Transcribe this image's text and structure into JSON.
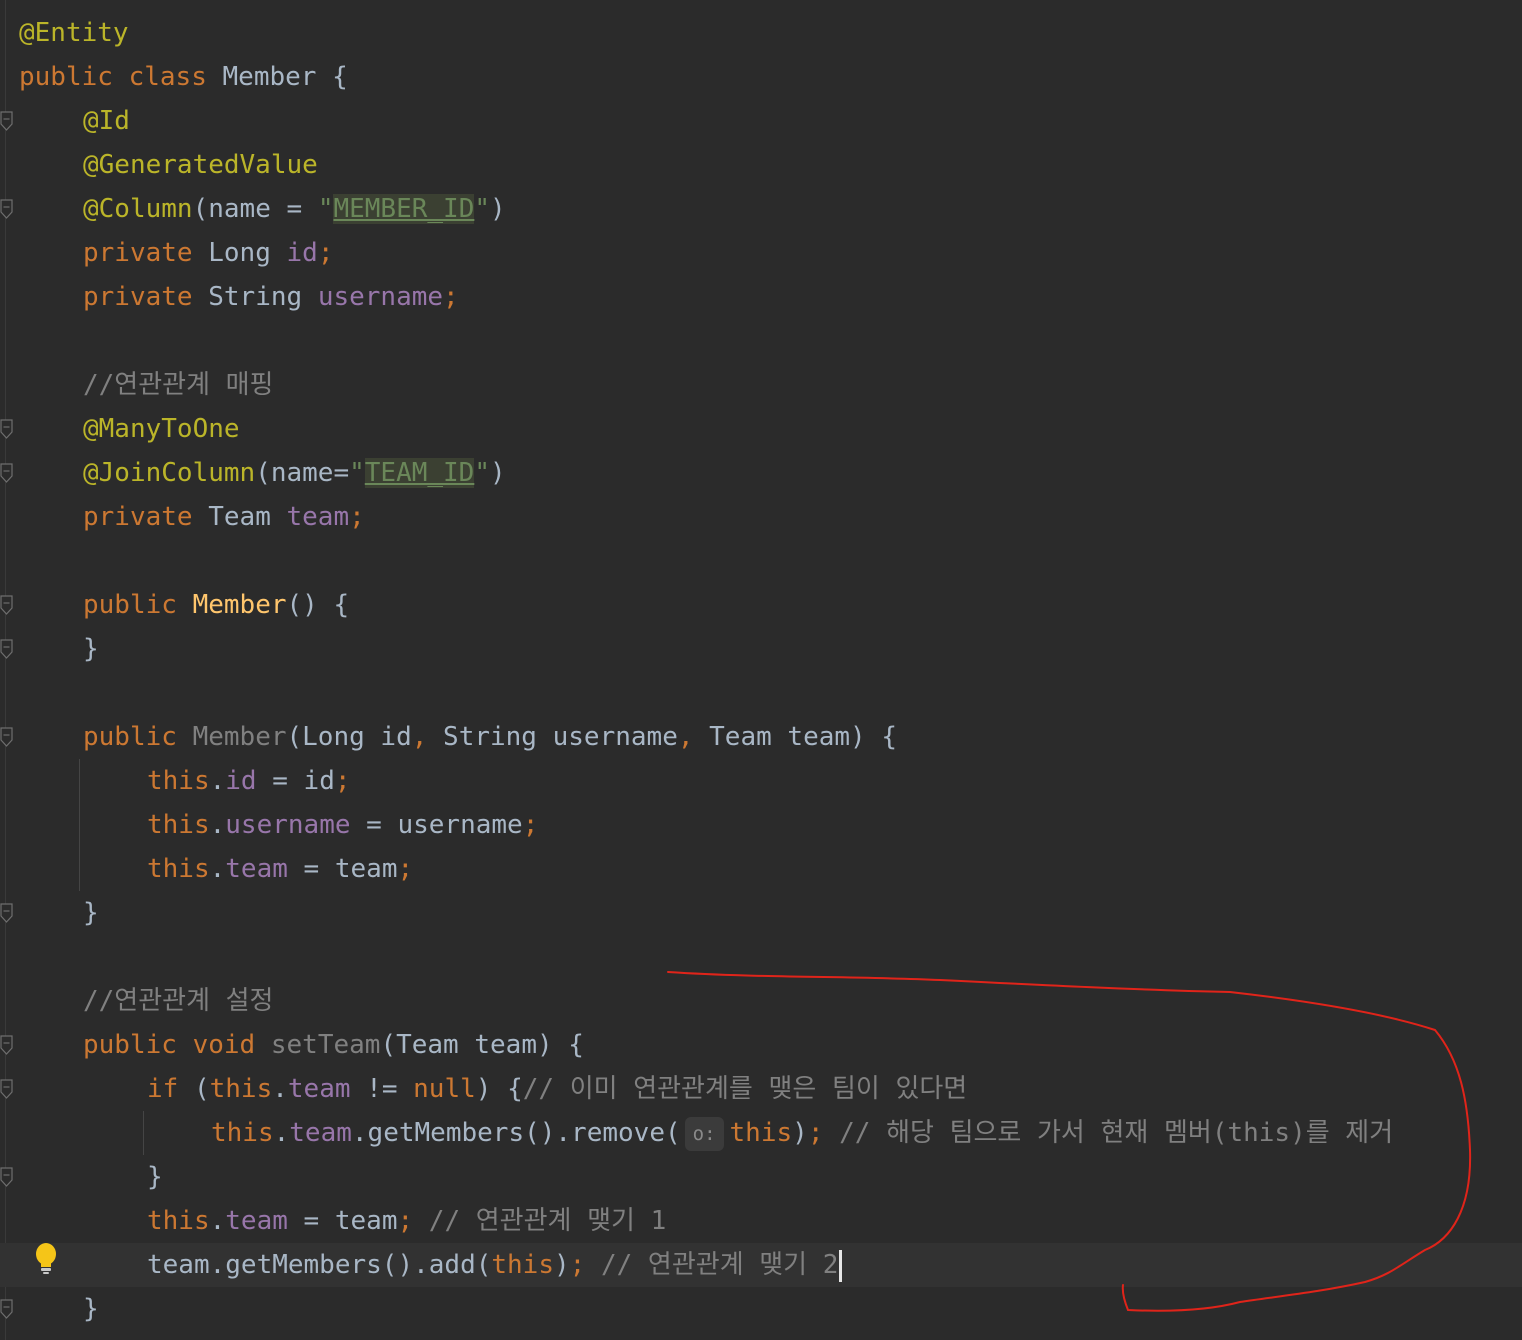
{
  "editor": {
    "lines": [
      [
        {
          "t": "@Entity",
          "c": "ann"
        }
      ],
      [
        {
          "t": "public",
          "c": "kw"
        },
        {
          "t": " "
        },
        {
          "t": "class",
          "c": "kw"
        },
        {
          "t": " Member {"
        }
      ],
      [
        {
          "t": "@Id",
          "c": "ann"
        }
      ],
      [
        {
          "t": "@GeneratedValue",
          "c": "ann"
        }
      ],
      [
        {
          "t": "@Column",
          "c": "ann"
        },
        {
          "t": "(name = "
        },
        {
          "t": "\"",
          "c": "str"
        },
        {
          "t": "MEMBER_ID",
          "c": "str ref"
        },
        {
          "t": "\"",
          "c": "str"
        },
        {
          "t": ")"
        }
      ],
      [
        {
          "t": "private",
          "c": "kw"
        },
        {
          "t": " Long "
        },
        {
          "t": "id",
          "c": "fld"
        },
        {
          "t": ";",
          "c": "kw"
        }
      ],
      [
        {
          "t": "private",
          "c": "kw"
        },
        {
          "t": " String "
        },
        {
          "t": "username",
          "c": "fld"
        },
        {
          "t": ";",
          "c": "kw"
        }
      ],
      [],
      [
        {
          "t": "//연관관계 매핑",
          "c": "cmt"
        }
      ],
      [
        {
          "t": "@ManyToOne",
          "c": "ann"
        }
      ],
      [
        {
          "t": "@JoinColumn",
          "c": "ann"
        },
        {
          "t": "(name="
        },
        {
          "t": "\"",
          "c": "str"
        },
        {
          "t": "TEAM_ID",
          "c": "str ref"
        },
        {
          "t": "\"",
          "c": "str"
        },
        {
          "t": ")"
        }
      ],
      [
        {
          "t": "private",
          "c": "kw"
        },
        {
          "t": " Team "
        },
        {
          "t": "team",
          "c": "fld"
        },
        {
          "t": ";",
          "c": "kw"
        }
      ],
      [],
      [
        {
          "t": "public",
          "c": "kw"
        },
        {
          "t": " "
        },
        {
          "t": "Member",
          "c": "fn"
        },
        {
          "t": "() {"
        }
      ],
      [
        {
          "t": "}"
        }
      ],
      [],
      [
        {
          "t": "public",
          "c": "kw"
        },
        {
          "t": " "
        },
        {
          "t": "Member",
          "c": "unused"
        },
        {
          "t": "(Long id"
        },
        {
          "t": ",",
          "c": "kw"
        },
        {
          "t": " String username"
        },
        {
          "t": ",",
          "c": "kw"
        },
        {
          "t": " Team team) {"
        }
      ],
      [
        {
          "t": "this",
          "c": "kw"
        },
        {
          "t": "."
        },
        {
          "t": "id",
          "c": "fld"
        },
        {
          "t": " = id"
        },
        {
          "t": ";",
          "c": "kw"
        }
      ],
      [
        {
          "t": "this",
          "c": "kw"
        },
        {
          "t": "."
        },
        {
          "t": "username",
          "c": "fld"
        },
        {
          "t": " = username"
        },
        {
          "t": ";",
          "c": "kw"
        }
      ],
      [
        {
          "t": "this",
          "c": "kw"
        },
        {
          "t": "."
        },
        {
          "t": "team",
          "c": "fld"
        },
        {
          "t": " = team"
        },
        {
          "t": ";",
          "c": "kw"
        }
      ],
      [
        {
          "t": "}"
        }
      ],
      [],
      [
        {
          "t": "//연관관계 설정",
          "c": "cmt"
        }
      ],
      [
        {
          "t": "public",
          "c": "kw"
        },
        {
          "t": " "
        },
        {
          "t": "void",
          "c": "kw"
        },
        {
          "t": " "
        },
        {
          "t": "setTeam",
          "c": "unused"
        },
        {
          "t": "(Team team) {"
        }
      ],
      [
        {
          "t": "if",
          "c": "kw"
        },
        {
          "t": " ("
        },
        {
          "t": "this",
          "c": "kw"
        },
        {
          "t": "."
        },
        {
          "t": "team",
          "c": "fld"
        },
        {
          "t": " != "
        },
        {
          "t": "null",
          "c": "kw"
        },
        {
          "t": ") {"
        },
        {
          "t": "// 이미 연관관계를 맺은 팀이 있다면",
          "c": "cmt"
        }
      ],
      [
        {
          "t": "this",
          "c": "kw"
        },
        {
          "t": "."
        },
        {
          "t": "team",
          "c": "fld"
        },
        {
          "t": ".getMembers().remove("
        },
        {
          "t": "o:",
          "c": "hint"
        },
        {
          "t": "this",
          "c": "kw"
        },
        {
          "t": ")"
        },
        {
          "t": ";",
          "c": "kw"
        },
        {
          "t": " "
        },
        {
          "t": "// 해당 팀으로 가서 현재 멤버(this)를 제거",
          "c": "cmt"
        }
      ],
      [
        {
          "t": "}"
        }
      ],
      [
        {
          "t": "this",
          "c": "kw"
        },
        {
          "t": "."
        },
        {
          "t": "team",
          "c": "fld"
        },
        {
          "t": " = team"
        },
        {
          "t": ";",
          "c": "kw"
        },
        {
          "t": " "
        },
        {
          "t": "// 연관관계 맺기 1",
          "c": "cmt"
        }
      ],
      [
        {
          "t": "team.getMembers().add("
        },
        {
          "t": "this",
          "c": "kw"
        },
        {
          "t": ")"
        },
        {
          "t": ";",
          "c": "kw"
        },
        {
          "t": " "
        },
        {
          "t": "// 연관관계 맺기 2",
          "c": "cmt"
        }
      ],
      [
        {
          "t": "}"
        }
      ]
    ],
    "current_line": 28,
    "intention_icon": "lightbulb-icon"
  },
  "colors": {
    "background": "#2b2b2b",
    "keyword": "#cc7832",
    "annotation": "#bbb529",
    "field": "#9876aa",
    "string": "#6a8759",
    "comment": "#808080",
    "method": "#ffc66d",
    "text": "#a9b7c6",
    "red_annotation": "#e0241a"
  }
}
